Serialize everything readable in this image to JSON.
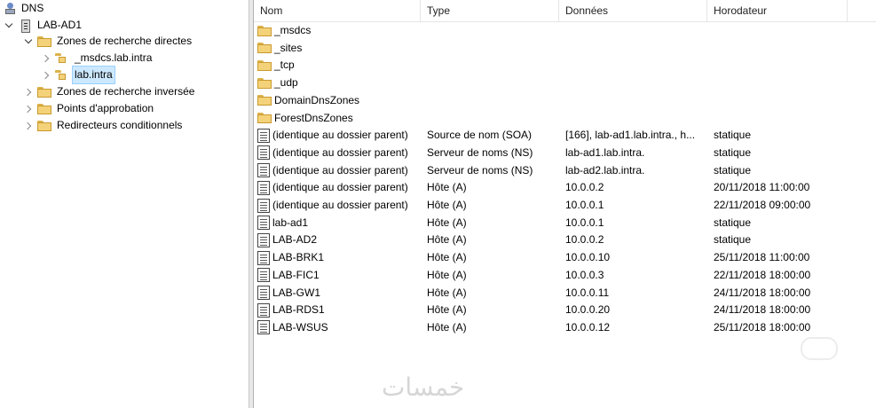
{
  "tree": {
    "root": {
      "label": "DNS",
      "icon": "dns-icon"
    },
    "server": {
      "label": "LAB-AD1",
      "icon": "server-icon"
    },
    "forward_zones": {
      "label": "Zones de recherche directes",
      "icon": "folder-icon"
    },
    "zone_msdcs": {
      "label": "_msdcs.lab.intra",
      "icon": "zone-icon"
    },
    "zone_lab": {
      "label": "lab.intra",
      "icon": "zone-icon",
      "selected": true
    },
    "reverse_zones": {
      "label": "Zones de recherche inversée",
      "icon": "folder-icon"
    },
    "trust_points": {
      "label": "Points d'approbation",
      "icon": "folder-icon"
    },
    "cond_forwarders": {
      "label": "Redirecteurs conditionnels",
      "icon": "folder-icon"
    }
  },
  "columns": {
    "name": "Nom",
    "type": "Type",
    "data": "Données",
    "timestamp": "Horodateur"
  },
  "rows": [
    {
      "name": "_msdcs",
      "type": "",
      "data": "",
      "ts": "",
      "icon": "folder"
    },
    {
      "name": "_sites",
      "type": "",
      "data": "",
      "ts": "",
      "icon": "folder"
    },
    {
      "name": "_tcp",
      "type": "",
      "data": "",
      "ts": "",
      "icon": "folder"
    },
    {
      "name": "_udp",
      "type": "",
      "data": "",
      "ts": "",
      "icon": "folder"
    },
    {
      "name": "DomainDnsZones",
      "type": "",
      "data": "",
      "ts": "",
      "icon": "folder"
    },
    {
      "name": "ForestDnsZones",
      "type": "",
      "data": "",
      "ts": "",
      "icon": "folder"
    },
    {
      "name": "(identique au dossier parent)",
      "type": "Source de nom (SOA)",
      "data": "[166], lab-ad1.lab.intra., h...",
      "ts": "statique",
      "icon": "record"
    },
    {
      "name": "(identique au dossier parent)",
      "type": "Serveur de noms (NS)",
      "data": "lab-ad1.lab.intra.",
      "ts": "statique",
      "icon": "record"
    },
    {
      "name": "(identique au dossier parent)",
      "type": "Serveur de noms (NS)",
      "data": "lab-ad2.lab.intra.",
      "ts": "statique",
      "icon": "record"
    },
    {
      "name": "(identique au dossier parent)",
      "type": "Hôte (A)",
      "data": "10.0.0.2",
      "ts": "20/11/2018 11:00:00",
      "icon": "record"
    },
    {
      "name": "(identique au dossier parent)",
      "type": "Hôte (A)",
      "data": "10.0.0.1",
      "ts": "22/11/2018 09:00:00",
      "icon": "record"
    },
    {
      "name": "lab-ad1",
      "type": "Hôte (A)",
      "data": "10.0.0.1",
      "ts": "statique",
      "icon": "record"
    },
    {
      "name": "LAB-AD2",
      "type": "Hôte (A)",
      "data": "10.0.0.2",
      "ts": "statique",
      "icon": "record"
    },
    {
      "name": "LAB-BRK1",
      "type": "Hôte (A)",
      "data": "10.0.0.10",
      "ts": "25/11/2018 11:00:00",
      "icon": "record"
    },
    {
      "name": "LAB-FIC1",
      "type": "Hôte (A)",
      "data": "10.0.0.3",
      "ts": "22/11/2018 18:00:00",
      "icon": "record"
    },
    {
      "name": "LAB-GW1",
      "type": "Hôte (A)",
      "data": "10.0.0.11",
      "ts": "24/11/2018 18:00:00",
      "icon": "record"
    },
    {
      "name": "LAB-RDS1",
      "type": "Hôte (A)",
      "data": "10.0.0.20",
      "ts": "24/11/2018 18:00:00",
      "icon": "record"
    },
    {
      "name": "LAB-WSUS",
      "type": "Hôte (A)",
      "data": "10.0.0.12",
      "ts": "25/11/2018 18:00:00",
      "icon": "record"
    }
  ],
  "watermark": "خمسات"
}
